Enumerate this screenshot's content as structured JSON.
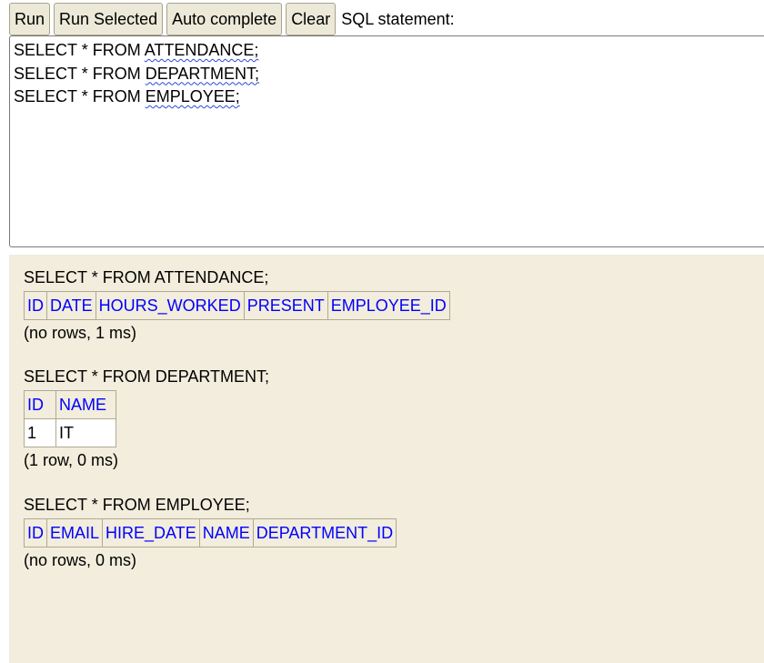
{
  "toolbar": {
    "run_label": "Run",
    "run_selected_label": "Run Selected",
    "auto_complete_label": "Auto complete",
    "clear_label": "Clear",
    "sql_statement_label": "SQL statement:"
  },
  "editor": {
    "lines": [
      {
        "prefix": "SELECT * FROM ",
        "table": "ATTENDANCE;"
      },
      {
        "prefix": "SELECT * FROM ",
        "table": "DEPARTMENT;"
      },
      {
        "prefix": "SELECT * FROM ",
        "table": "EMPLOYEE;"
      }
    ]
  },
  "results": [
    {
      "sql": "SELECT * FROM ATTENDANCE;",
      "columns": [
        "ID",
        "DATE",
        "HOURS_WORKED",
        "PRESENT",
        "EMPLOYEE_ID"
      ],
      "rows": [],
      "status": "(no rows, 1 ms)"
    },
    {
      "sql": "SELECT * FROM DEPARTMENT;",
      "columns": [
        "ID",
        "NAME"
      ],
      "rows": [
        [
          "1",
          "IT"
        ]
      ],
      "status": "(1 row, 0 ms)"
    },
    {
      "sql": "SELECT * FROM EMPLOYEE;",
      "columns": [
        "ID",
        "EMAIL",
        "HIRE_DATE",
        "NAME",
        "DEPARTMENT_ID"
      ],
      "rows": [],
      "status": "(no rows, 0 ms)"
    }
  ],
  "colors": {
    "header_text": "#0000ff",
    "results_background": "#f2eddc",
    "button_background": "#ece9d8"
  }
}
